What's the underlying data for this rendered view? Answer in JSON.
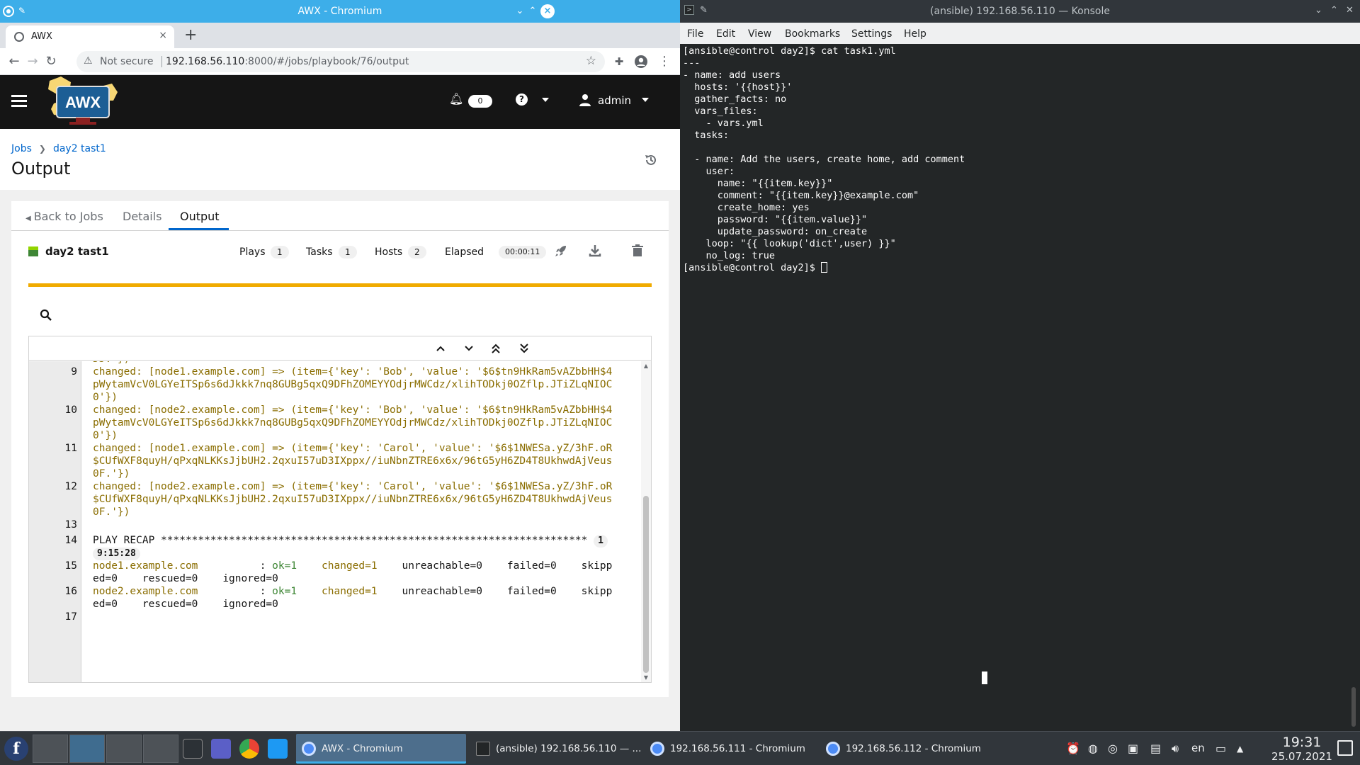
{
  "chromium": {
    "window_title": "AWX - Chromium",
    "tab_title": "AWX",
    "tab_close": "×",
    "new_tab": "+",
    "not_secure": "Not secure",
    "url_host": "192.168.56.110",
    "url_rest": ":8000/#/jobs/playbook/76/output"
  },
  "awx": {
    "logo_text": "AWX",
    "notification_count": "0",
    "user_name": "admin",
    "breadcrumb": [
      "Jobs",
      "day2 tast1"
    ],
    "page_title": "Output",
    "tabs": [
      "Back to Jobs",
      "Details",
      "Output"
    ],
    "job": {
      "name": "day2 tast1",
      "status_color": "#3e8635",
      "plays_label": "Plays",
      "plays": "1",
      "tasks_label": "Tasks",
      "tasks": "1",
      "hosts_label": "Hosts",
      "hosts": "2",
      "elapsed_label": "Elapsed",
      "elapsed": "00:00:11"
    },
    "output_lines": [
      {
        "n": "",
        "t": "DJ.'})",
        "c": "chg"
      },
      {
        "n": "9",
        "t": "changed: [node1.example.com] => (item={'key': 'Bob', 'value': '$6$tn9HkRam5vAZbbHH$4",
        "c": "chg"
      },
      {
        "n": "",
        "t": "pWytamVcV0LGYeITSp6s6dJkkk7nq8GUBg5qxQ9DFhZOMEYYOdjrMWCdz/xlihTODkj0OZflp.JTiZLqNIOC",
        "c": "chg"
      },
      {
        "n": "",
        "t": "0'})",
        "c": "chg"
      },
      {
        "n": "10",
        "t": "changed: [node2.example.com] => (item={'key': 'Bob', 'value': '$6$tn9HkRam5vAZbbHH$4",
        "c": "chg"
      },
      {
        "n": "",
        "t": "pWytamVcV0LGYeITSp6s6dJkkk7nq8GUBg5qxQ9DFhZOMEYYOdjrMWCdz/xlihTODkj0OZflp.JTiZLqNIOC",
        "c": "chg"
      },
      {
        "n": "",
        "t": "0'})",
        "c": "chg"
      },
      {
        "n": "11",
        "t": "changed: [node1.example.com] => (item={'key': 'Carol', 'value': '$6$1NWESa.yZ/3hF.oR",
        "c": "chg"
      },
      {
        "n": "",
        "t": "$CUfWXF8quyH/qPxqNLKKsJjbUH2.2qxuI57uD3IXppx//iuNbnZTRE6x6x/96tG5yH6ZD4T8UkhwdAjVeus",
        "c": "chg"
      },
      {
        "n": "",
        "t": "0F.'})",
        "c": "chg"
      },
      {
        "n": "12",
        "t": "changed: [node2.example.com] => (item={'key': 'Carol', 'value': '$6$1NWESa.yZ/3hF.oR",
        "c": "chg"
      },
      {
        "n": "",
        "t": "$CUfWXF8quyH/qPxqNLKKsJjbUH2.2qxuI57uD3IXppx//iuNbnZTRE6x6x/96tG5yH6ZD4T8UkhwdAjVeus",
        "c": "chg"
      },
      {
        "n": "",
        "t": "0F.'})",
        "c": "chg"
      },
      {
        "n": "13",
        "t": "",
        "c": "plain"
      }
    ],
    "recap": {
      "line14_num": "14",
      "line14_text": "PLAY RECAP *********************************************************************",
      "line14_badge_a": "1",
      "line14_badge_b": "9:15:28",
      "line15_num": "15",
      "node1_host": "node1.example.com",
      "node1_sep": "          : ",
      "node1_ok": "ok=1",
      "node1_changed": "    changed=1",
      "node1_rest": "    unreachable=0    failed=0    skipp",
      "node1_wrap": "ed=0    rescued=0    ignored=0",
      "line16_num": "16",
      "node2_host": "node2.example.com",
      "node2_sep": "          : ",
      "node2_ok": "ok=1",
      "node2_changed": "    changed=1",
      "node2_rest": "    unreachable=0    failed=0    skipp",
      "node2_wrap": "ed=0    rescued=0    ignored=0",
      "line17_num": "17"
    }
  },
  "konsole": {
    "window_title": "(ansible) 192.168.56.110 — Konsole",
    "menu": [
      "File",
      "Edit",
      "View",
      "Bookmarks",
      "Settings",
      "Help"
    ],
    "terminal_lines": [
      "[ansible@control day2]$ cat task1.yml",
      "---",
      "- name: add users",
      "  hosts: '{{host}}'",
      "  gather_facts: no",
      "  vars_files:",
      "    - vars.yml",
      "  tasks:",
      "",
      "  - name: Add the users, create home, add comment",
      "    user:",
      "      name: \"{{item.key}}\"",
      "      comment: \"{{item.key}}@example.com\"",
      "      create_home: yes",
      "      password: \"{{item.value}}\"",
      "      update_password: on_create",
      "    loop: \"{{ lookup('dict',user) }}\"",
      "    no_log: true"
    ],
    "prompt": "[ansible@control day2]$ "
  },
  "taskbar": {
    "tasks": [
      {
        "title": "AWX - Chromium",
        "active": true
      },
      {
        "title": "(ansible) 192.168.56.110 — ...",
        "active": false
      },
      {
        "title": "192.168.56.111 - Chromium",
        "active": false
      },
      {
        "title": "192.168.56.112 - Chromium",
        "active": false
      }
    ],
    "language": "en",
    "time": "19:31",
    "date": "25.07.2021"
  }
}
